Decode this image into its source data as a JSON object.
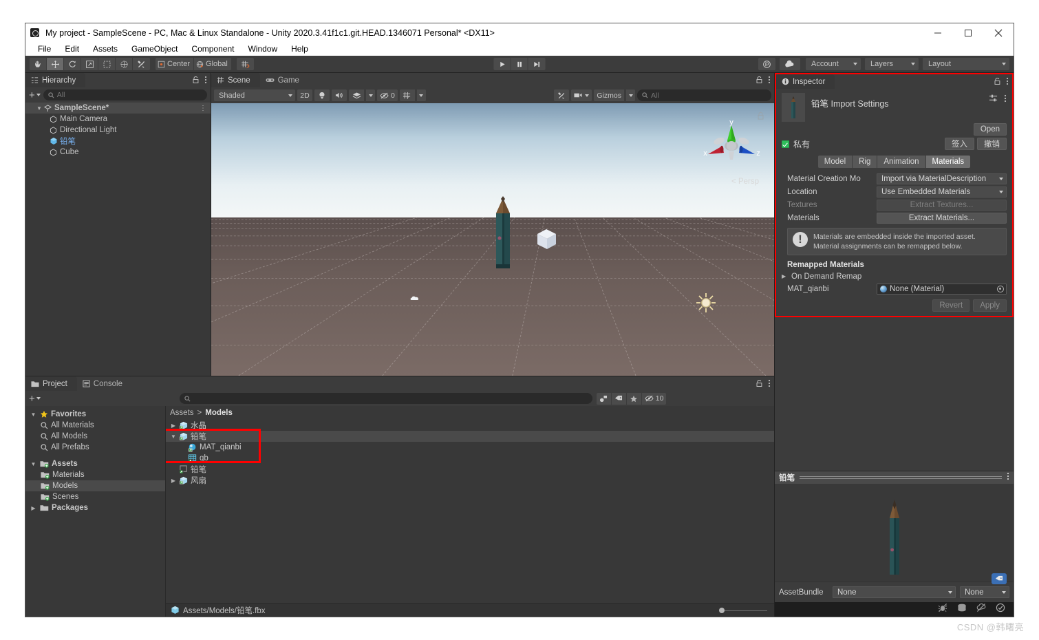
{
  "window": {
    "title": "My project - SampleScene - PC, Mac & Linux Standalone - Unity 2020.3.41f1c1.git.HEAD.1346071 Personal* <DX11>",
    "minimize_label": "Minimize",
    "maximize_label": "Maximize",
    "close_label": "Close"
  },
  "menu": {
    "items": [
      "File",
      "Edit",
      "Assets",
      "GameObject",
      "Component",
      "Window",
      "Help"
    ]
  },
  "toolbar": {
    "tools": [
      "hand-tool",
      "move-tool",
      "rotate-tool",
      "scale-tool",
      "rect-tool",
      "transform-tool",
      "custom-tool"
    ],
    "pivot_label": "Center",
    "handle_label": "Global",
    "grid_label": "grid-snap",
    "play_label": "Play",
    "pause_label": "Pause",
    "step_label": "Step",
    "collab_label": "collab",
    "cloud_label": "cloud",
    "account_label": "Account",
    "layers_label": "Layers",
    "layout_label": "Layout"
  },
  "hierarchy": {
    "tab_label": "Hierarchy",
    "search_placeholder": "All",
    "add_label": "+",
    "items": [
      {
        "label": "SampleScene*",
        "indent": 0,
        "expanded": true,
        "selected": false,
        "icon": "scene-icon",
        "bold": true
      },
      {
        "label": "Main Camera",
        "indent": 1,
        "selected": false,
        "icon": "gameobject-icon",
        "bold": false
      },
      {
        "label": "Directional Light",
        "indent": 1,
        "selected": false,
        "icon": "gameobject-icon",
        "bold": false
      },
      {
        "label": "铅笔",
        "indent": 1,
        "selected": true,
        "icon": "prefab-icon",
        "bold": false
      },
      {
        "label": "Cube",
        "indent": 1,
        "selected": false,
        "icon": "gameobject-icon",
        "bold": false
      }
    ]
  },
  "scene": {
    "tabs": [
      {
        "label": "Scene",
        "active": true,
        "icon": "scene-tab-icon"
      },
      {
        "label": "Game",
        "active": false,
        "icon": "game-tab-icon"
      }
    ],
    "draw_mode": "Shaded",
    "two_d_label": "2D",
    "light_label": "lighting-toggle",
    "audio_label": "audio-toggle",
    "fx_label": "effects-toggle",
    "hidden_count": "0",
    "grid_label": "grid-visibility",
    "tools_label": "scene-tools",
    "camera_label": "scene-camera",
    "gizmos_label": "Gizmos",
    "search_placeholder": "All",
    "axis_x": "x",
    "axis_y": "y",
    "axis_z": "z",
    "persp_label": "< Persp"
  },
  "project": {
    "tabs": [
      {
        "label": "Project",
        "active": true,
        "icon": "project-tab-icon"
      },
      {
        "label": "Console",
        "active": false,
        "icon": "console-tab-icon"
      }
    ],
    "add_label": "+",
    "search_placeholder": "",
    "hidden_count": "10",
    "tree": [
      {
        "label": "Favorites",
        "indent": 0,
        "expanded": true,
        "icon": "star-icon",
        "bold": true,
        "selected": false
      },
      {
        "label": "All Materials",
        "indent": 1,
        "icon": "search-icon",
        "bold": false,
        "selected": false
      },
      {
        "label": "All Models",
        "indent": 1,
        "icon": "search-icon",
        "bold": false,
        "selected": false
      },
      {
        "label": "All Prefabs",
        "indent": 1,
        "icon": "search-icon",
        "bold": false,
        "selected": false
      },
      {
        "label": "Assets",
        "indent": 0,
        "expanded": true,
        "icon": "assets-folder-icon",
        "bold": true,
        "selected": false
      },
      {
        "label": "Materials",
        "indent": 1,
        "icon": "folder-icon",
        "bold": false,
        "selected": false
      },
      {
        "label": "Models",
        "indent": 1,
        "icon": "folder-icon",
        "bold": false,
        "selected": true
      },
      {
        "label": "Scenes",
        "indent": 1,
        "icon": "folder-icon",
        "bold": false,
        "selected": false
      },
      {
        "label": "Packages",
        "indent": 0,
        "expanded": false,
        "icon": "packages-folder-icon",
        "bold": true,
        "selected": false
      }
    ],
    "breadcrumb": {
      "root": "Assets",
      "sep": ">",
      "current": "Models"
    },
    "items": [
      {
        "label": "水晶",
        "indent": 0,
        "arrow": "collapsed",
        "icon": "model-icon",
        "selected": false
      },
      {
        "label": "铅笔",
        "indent": 0,
        "arrow": "expanded",
        "icon": "model-icon",
        "selected": true
      },
      {
        "label": "MAT_qianbi",
        "indent": 1,
        "arrow": "none",
        "icon": "material-icon",
        "selected": false
      },
      {
        "label": "qb",
        "indent": 1,
        "arrow": "none",
        "icon": "texture-icon",
        "selected": false
      },
      {
        "label": "铅笔",
        "indent": 0,
        "arrow": "none",
        "icon": "prefab-model-icon",
        "selected": false
      },
      {
        "label": "风扇",
        "indent": 0,
        "arrow": "collapsed",
        "icon": "model-icon",
        "selected": false
      }
    ],
    "status_path": "Assets/Models/铅笔.fbx"
  },
  "inspector": {
    "tab_label": "Inspector",
    "asset_name": "铅笔",
    "asset_title_suffix": " Import Settings",
    "open_label": "Open",
    "owner_label": "私有",
    "checkin_label": "签入",
    "revert_vcs_label": "撤销",
    "tabs": [
      {
        "label": "Model",
        "active": false
      },
      {
        "label": "Rig",
        "active": false
      },
      {
        "label": "Animation",
        "active": false
      },
      {
        "label": "Materials",
        "active": true
      }
    ],
    "fields": [
      {
        "label": "Material Creation Mo",
        "value": "Import via MaterialDescription",
        "type": "dropdown",
        "disabled": false
      },
      {
        "label": "Location",
        "value": "Use Embedded Materials",
        "type": "dropdown",
        "disabled": false
      },
      {
        "label": "Textures",
        "value": "Extract Textures...",
        "type": "button",
        "disabled": true
      },
      {
        "label": "Materials",
        "value": "Extract Materials...",
        "type": "button",
        "disabled": false
      }
    ],
    "help_line1": "Materials are embedded inside the imported asset.",
    "help_line2": "Material assignments can be remapped below.",
    "remapped_header": "Remapped Materials",
    "on_demand_label": "On Demand Remap",
    "remap_entry_label": "MAT_qianbi",
    "remap_entry_value": "None (Material)",
    "revert_label": "Revert",
    "apply_label": "Apply",
    "preview_name": "铅笔",
    "assetbundle_label": "AssetBundle",
    "assetbundle_value": "None",
    "assetbundle_variant": "None"
  },
  "watermark": "CSDN @韩曙亮",
  "colors": {
    "highlight_red": "#ff0000",
    "panel_bg": "#383838",
    "chrome_bg": "#3c3c3c",
    "accent_blue": "#7ab4f5"
  }
}
